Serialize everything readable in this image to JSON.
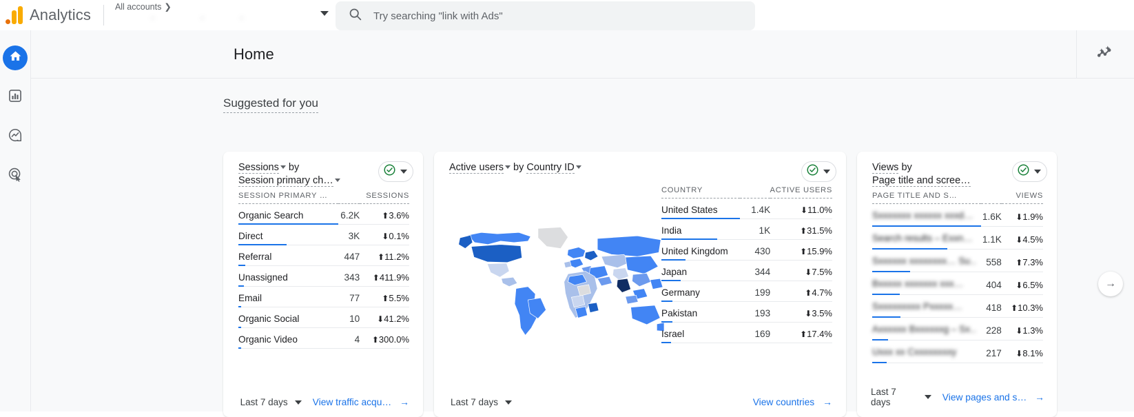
{
  "header": {
    "brand": "Analytics",
    "account_breadcrumb": "All accounts",
    "account_blur": "•",
    "search_placeholder": "Try searching \"link with Ads\""
  },
  "sidebar": {
    "items": [
      {
        "name": "home",
        "label": "Home",
        "active": true
      },
      {
        "name": "reports",
        "label": "Reports",
        "active": false
      },
      {
        "name": "explore",
        "label": "Explore",
        "active": false
      },
      {
        "name": "advertising",
        "label": "Advertising",
        "active": false
      }
    ]
  },
  "page": {
    "title": "Home",
    "section_title": "Suggested for you",
    "insights_icon": "insights-sparkle-icon",
    "next_arrow": "→"
  },
  "colors": {
    "accent": "#1a73e8",
    "brand_orange": "#f9ab00",
    "brand_orange_dark": "#e8710a",
    "up": "#188038",
    "down": "#d93025",
    "bar": "#1a73e8",
    "surface": "#f8f9fa"
  },
  "cards": [
    {
      "id": "sessions-by-channel",
      "metric": "Sessions",
      "by": "by",
      "dimension": "Session primary ch…",
      "badge_icon": "check-circle-icon",
      "columns": [
        "SESSION PRIMARY …",
        "SESSIONS"
      ],
      "rows": [
        {
          "label": "Organic Search",
          "value": "6.2K",
          "raw": 6200,
          "delta": "3.6%",
          "dir": "up"
        },
        {
          "label": "Direct",
          "value": "3K",
          "raw": 3000,
          "delta": "0.1%",
          "dir": "down"
        },
        {
          "label": "Referral",
          "value": "447",
          "raw": 447,
          "delta": "11.2%",
          "dir": "up"
        },
        {
          "label": "Unassigned",
          "value": "343",
          "raw": 343,
          "delta": "411.9%",
          "dir": "up"
        },
        {
          "label": "Email",
          "value": "77",
          "raw": 77,
          "delta": "5.5%",
          "dir": "up"
        },
        {
          "label": "Organic Social",
          "value": "10",
          "raw": 10,
          "delta": "41.2%",
          "dir": "down"
        },
        {
          "label": "Organic Video",
          "value": "4",
          "raw": 4,
          "delta": "300.0%",
          "dir": "up"
        }
      ],
      "date_range": "Last 7 days",
      "link": "View traffic acqu…"
    },
    {
      "id": "active-users-by-country",
      "metric": "Active users",
      "by": "by",
      "dimension": "Country ID",
      "badge_icon": "check-circle-icon",
      "columns": [
        "COUNTRY",
        "ACTIVE USERS"
      ],
      "rows": [
        {
          "label": "United States",
          "value": "1.4K",
          "raw": 1400,
          "delta": "11.0%",
          "dir": "down"
        },
        {
          "label": "India",
          "value": "1K",
          "raw": 1000,
          "delta": "31.5%",
          "dir": "up"
        },
        {
          "label": "United Kingdom",
          "value": "430",
          "raw": 430,
          "delta": "15.9%",
          "dir": "up"
        },
        {
          "label": "Japan",
          "value": "344",
          "raw": 344,
          "delta": "7.5%",
          "dir": "down"
        },
        {
          "label": "Germany",
          "value": "199",
          "raw": 199,
          "delta": "4.7%",
          "dir": "up"
        },
        {
          "label": "Pakistan",
          "value": "193",
          "raw": 193,
          "delta": "3.5%",
          "dir": "down"
        },
        {
          "label": "Israel",
          "value": "169",
          "raw": 169,
          "delta": "17.4%",
          "dir": "up"
        }
      ],
      "date_range": "Last 7 days",
      "link": "View countries"
    },
    {
      "id": "views-by-page-title",
      "metric": "Views",
      "by": "by",
      "dimension": "Page title and scree…",
      "badge_icon": "check-circle-icon",
      "columns": [
        "PAGE TITLE AND S…",
        "VIEWS"
      ],
      "rows": [
        {
          "label": "Sxxxxxxx xxxxxx xxxd…",
          "value": "1.6K",
          "raw": 1600,
          "delta": "1.9%",
          "dir": "down",
          "blurred": true
        },
        {
          "label": "Search results – Exxn…",
          "value": "1.1K",
          "raw": 1100,
          "delta": "4.5%",
          "dir": "down",
          "blurred": true
        },
        {
          "label": "Sxxxxxx xxxxxxxx… Su…",
          "value": "558",
          "raw": 558,
          "delta": "7.3%",
          "dir": "up",
          "blurred": true
        },
        {
          "label": "Bxxxxx xxxxxxx xxx…",
          "value": "404",
          "raw": 404,
          "delta": "6.5%",
          "dir": "down",
          "blurred": true
        },
        {
          "label": "Sxxxxxxxxx Pxxxxx…",
          "value": "418",
          "raw": 418,
          "delta": "10.3%",
          "dir": "up",
          "blurred": true
        },
        {
          "label": "Axxxxxx Bxxxxxxg – Sx…",
          "value": "228",
          "raw": 228,
          "delta": "1.3%",
          "dir": "down",
          "blurred": true
        },
        {
          "label": "Uxxx xx Cxxxxxxxxy",
          "value": "217",
          "raw": 217,
          "delta": "8.1%",
          "dir": "down",
          "blurred": true
        }
      ],
      "date_range": "Last 7 days",
      "link": "View pages and s…"
    }
  ],
  "map": {
    "type": "choropleth",
    "title": "Active users by Country ID",
    "legend": "blue intensity = active users",
    "highlight_countries": [
      "United States",
      "India"
    ]
  }
}
